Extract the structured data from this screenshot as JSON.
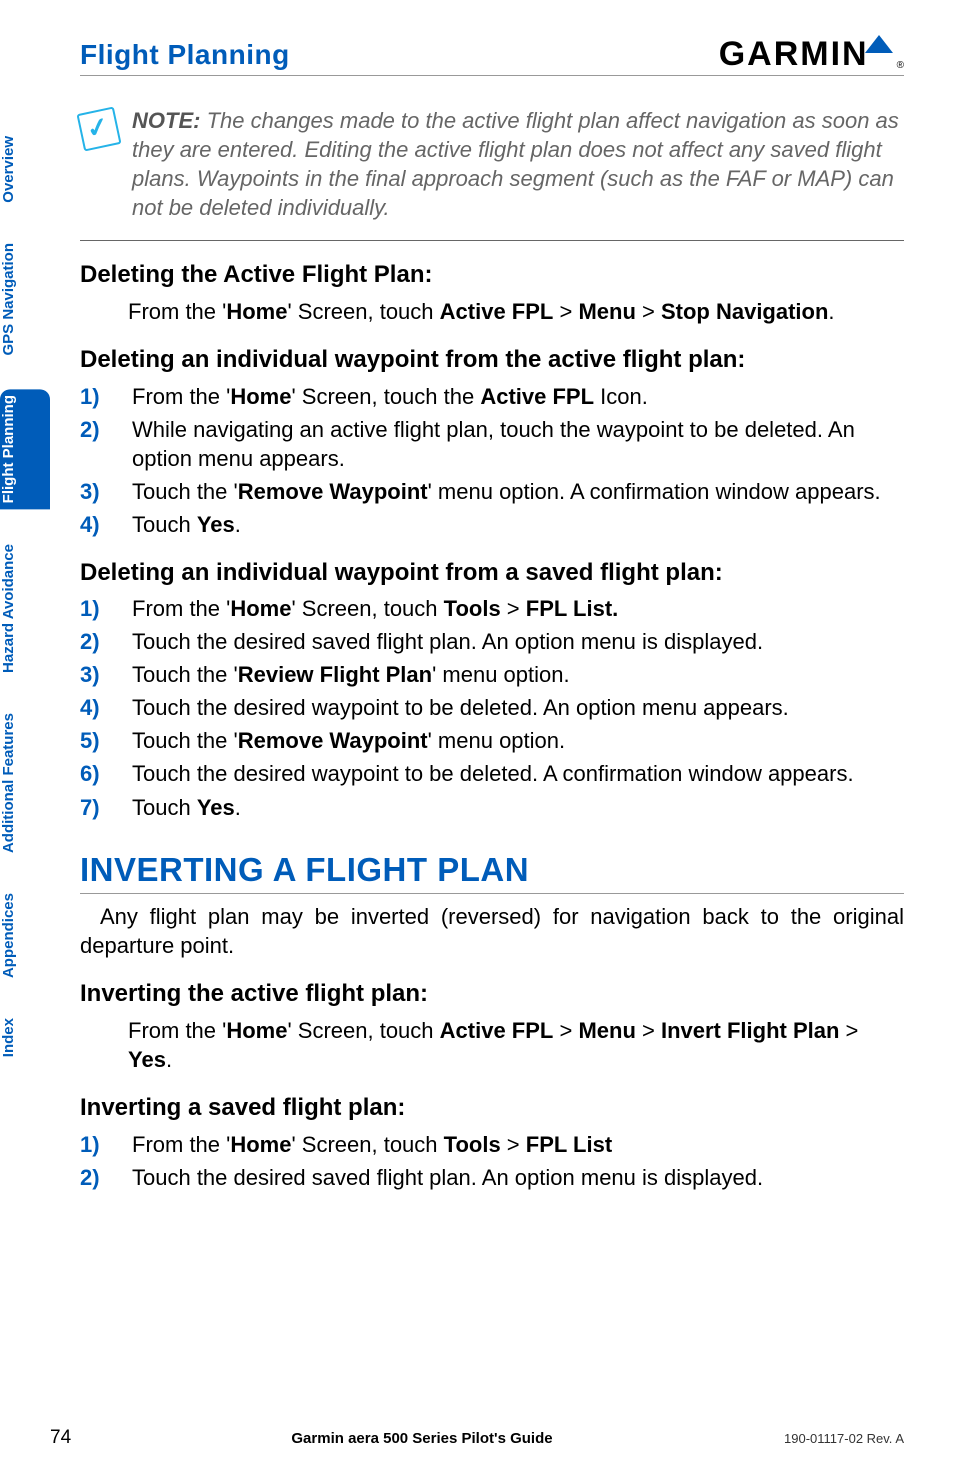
{
  "header": {
    "title": "Flight Planning",
    "logo_text": "GARMIN",
    "logo_mark": "®"
  },
  "tabs": [
    {
      "label": "Overview",
      "active": false
    },
    {
      "label": "GPS Navigation",
      "active": false
    },
    {
      "label": "Flight Planning",
      "active": true
    },
    {
      "label": "Hazard Avoidance",
      "active": false
    },
    {
      "label": "Additional Features",
      "active": false
    },
    {
      "label": "Appendices",
      "active": false
    },
    {
      "label": "Index",
      "active": false
    }
  ],
  "note": {
    "label": "NOTE:",
    "text": " The changes made to the active flight plan affect navigation as soon as they are entered.  Editing the active flight plan does not affect any saved flight plans.  Waypoints in the final approach segment (such as the FAF or MAP) can not be deleted individually."
  },
  "proc1": {
    "title": "Deleting the Active Flight Plan:",
    "line_pre": "From the '",
    "home": "Home",
    "line_mid1": "' Screen, touch ",
    "afpl": "Active FPL",
    "gt1": " > ",
    "menu": "Menu",
    "gt2": " > ",
    "stopnav": "Stop Navigation",
    "period": "."
  },
  "proc2": {
    "title": "Deleting an individual waypoint from the active flight plan:",
    "steps": [
      {
        "n": "1)",
        "pre": "From the '",
        "b1": "Home",
        "mid": "' Screen, touch the ",
        "b2": "Active FPL",
        "post": " Icon."
      },
      {
        "n": "2)",
        "plain": "While navigating an active flight plan, touch the waypoint to be deleted.  An option menu appears."
      },
      {
        "n": "3)",
        "pre": "Touch the '",
        "b1": "Remove Waypoint",
        "post": "' menu option.  A confirmation window appears."
      },
      {
        "n": "4)",
        "pre": "Touch ",
        "b1": "Yes",
        "post": "."
      }
    ]
  },
  "proc3": {
    "title": "Deleting an individual waypoint from a saved flight plan:",
    "steps": [
      {
        "n": "1)",
        "pre": "From the '",
        "b1": "Home",
        "mid": "' Screen, touch ",
        "b2": "Tools",
        "gt": " > ",
        "b3": "FPL List.",
        "post": ""
      },
      {
        "n": "2)",
        "plain": "Touch the desired saved flight plan.  An option menu is displayed."
      },
      {
        "n": "3)",
        "pre": "Touch the '",
        "b1": "Review Flight Plan",
        "post": "' menu option."
      },
      {
        "n": "4)",
        "plain": "Touch the desired waypoint to be deleted.  An option menu appears."
      },
      {
        "n": "5)",
        "pre": "Touch the '",
        "b1": "Remove Waypoint",
        "post": "' menu option."
      },
      {
        "n": "6)",
        "plain": "Touch the desired waypoint to be deleted.  A confirmation window appears."
      },
      {
        "n": "7)",
        "pre": "Touch ",
        "b1": "Yes",
        "post": "."
      }
    ]
  },
  "section2": {
    "heading": "INVERTING A FLIGHT PLAN",
    "body": "Any flight plan may be inverted (reversed) for navigation back to the original departure point."
  },
  "proc4": {
    "title": "Inverting the active flight plan:",
    "pre": "From the '",
    "home": "Home",
    "mid": "' Screen, touch ",
    "afpl": "Active FPL",
    "gt1": " > ",
    "menu": "Menu",
    "gt2": " > ",
    "inv": "Invert Flight Plan",
    "gt3": " > ",
    "yes": "Yes",
    "post": "."
  },
  "proc5": {
    "title": "Inverting a saved flight plan:",
    "steps": [
      {
        "n": "1)",
        "pre": "From the '",
        "b1": "Home",
        "mid": "' Screen, touch ",
        "b2": "Tools",
        "gt": " > ",
        "b3": "FPL List",
        "post": ""
      },
      {
        "n": "2)",
        "plain": "Touch the desired saved flight plan.  An option menu is displayed."
      }
    ]
  },
  "footer": {
    "page": "74",
    "center": "Garmin aera 500 Series Pilot's Guide",
    "right": "190-01117-02  Rev. A"
  }
}
